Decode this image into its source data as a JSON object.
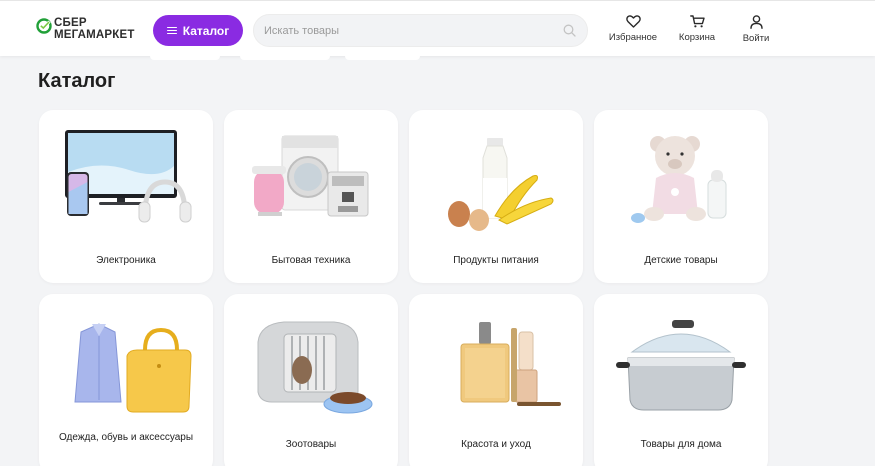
{
  "header": {
    "logo": {
      "line1": "СБЕР",
      "line2": "МЕГАМАРКЕТ",
      "mark_color": "#21a038"
    },
    "catalog_button": {
      "label": "Каталог",
      "icon": "menu-icon",
      "color": "#8a2be2"
    },
    "search": {
      "placeholder": "Искать товары",
      "value": "",
      "icon": "search-icon"
    },
    "actions": [
      {
        "label": "Избранное",
        "icon": "heart-icon"
      },
      {
        "label": "Корзина",
        "icon": "cart-icon"
      },
      {
        "label": "Войти",
        "icon": "user-icon"
      }
    ]
  },
  "main": {
    "title": "Каталог",
    "categories": [
      {
        "label": "Электроника",
        "image": "electronics"
      },
      {
        "label": "Бытовая техника",
        "image": "home-appliances"
      },
      {
        "label": "Продукты питания",
        "image": "food"
      },
      {
        "label": "Детские товары",
        "image": "kids"
      },
      {
        "label": "Одежда, обувь и аксессуары",
        "image": "clothing"
      },
      {
        "label": "Зоотовары",
        "image": "pets"
      },
      {
        "label": "Красота и уход",
        "image": "beauty"
      },
      {
        "label": "Товары для дома",
        "image": "home-goods"
      }
    ]
  }
}
